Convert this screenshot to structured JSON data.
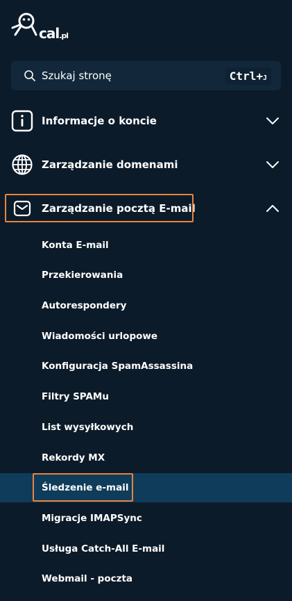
{
  "brand": {
    "name": "cal",
    "tld": ".pl"
  },
  "search": {
    "label": "Szukaj stronę",
    "shortcut_main": "Ctrl+",
    "shortcut_key": "J"
  },
  "sections": [
    {
      "label": "Informacje o koncie",
      "icon": "info-icon",
      "expanded": false
    },
    {
      "label": "Zarządzanie domenami",
      "icon": "globe-icon",
      "expanded": false
    },
    {
      "label": "Zarządzanie pocztą E-mail",
      "icon": "envelope-icon",
      "expanded": true
    }
  ],
  "email_items": [
    "Konta E-mail",
    "Przekierowania",
    "Autorespondery",
    "Wiadomości urlopowe",
    "Konfiguracja SpamAssassina",
    "Filtry SPAMu",
    "List wysyłkowych",
    "Rekordy MX",
    "Śledzenie e-mail",
    "Migracje IMAPSync",
    "Usługa Catch-All E-mail",
    "Webmail - poczta"
  ],
  "active_item": "Śledzenie e-mail",
  "colors": {
    "background": "#0c1b29",
    "search_bg": "#12283a",
    "active_bg": "#0f3c5a",
    "highlight": "#e8843d"
  }
}
